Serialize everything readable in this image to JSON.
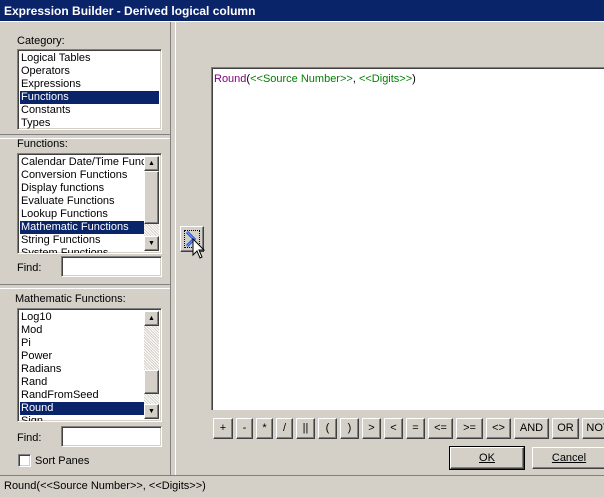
{
  "window": {
    "title": "Expression Builder - Derived logical column"
  },
  "category": {
    "label": "Category:",
    "items": [
      "Logical Tables",
      "Operators",
      "Expressions",
      "Functions",
      "Constants",
      "Types"
    ],
    "selected_index": 3
  },
  "functions": {
    "label": "Functions:",
    "items": [
      "Calendar Date/Time Funct",
      "Conversion Functions",
      "Display functions",
      "Evaluate Functions",
      "Lookup Functions",
      "Mathematic Functions",
      "String Functions",
      "System Functions"
    ],
    "selected_index": 5,
    "find_label": "Find:",
    "find_value": ""
  },
  "math_functions": {
    "label": "Mathematic Functions:",
    "items": [
      "Log10",
      "Mod",
      "Pi",
      "Power",
      "Radians",
      "Rand",
      "RandFromSeed",
      "Round",
      "Sign"
    ],
    "selected_index": 7,
    "find_label": "Find:",
    "find_value": ""
  },
  "sort_panes": {
    "label": "Sort Panes",
    "checked": false
  },
  "insert_button": {
    "icon": "chevron-right-icon"
  },
  "editor": {
    "tokens": [
      {
        "text": "Round",
        "kind": "func"
      },
      {
        "text": "(",
        "kind": "punct"
      },
      {
        "text": "<<Source Number>>",
        "kind": "arg"
      },
      {
        "text": ", ",
        "kind": "punct"
      },
      {
        "text": "<<Digits>>",
        "kind": "arg"
      },
      {
        "text": ")",
        "kind": "punct"
      }
    ]
  },
  "operators": [
    "+",
    "-",
    "*",
    "/",
    "||",
    "(",
    ")",
    ">",
    "<",
    "=",
    "<=",
    ">=",
    "<>",
    "AND",
    "OR",
    "NOT"
  ],
  "buttons": {
    "ok": "OK",
    "cancel": "Cancel"
  },
  "status": {
    "text": "Round(<<Source Number>>, <<Digits>>)"
  },
  "colors": {
    "selection": "#0a246a",
    "func": "#800080",
    "arg": "#008000",
    "face": "#d4d0c8"
  }
}
